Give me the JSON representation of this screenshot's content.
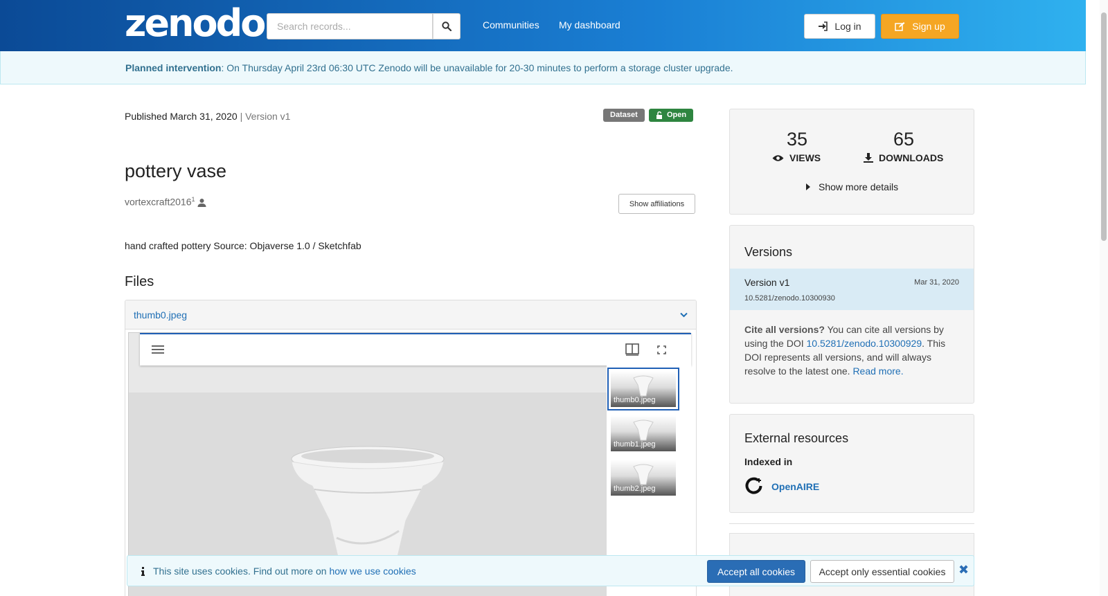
{
  "header": {
    "logo": "zenodo",
    "search_placeholder": "Search records...",
    "nav": [
      "Communities",
      "My dashboard"
    ],
    "login_label": "Log in",
    "signup_label": "Sign up"
  },
  "alert": {
    "bold": "Planned intervention",
    "text": ": On Thursday April 23rd 06:30 UTC Zenodo will be unavailable for 20-30 minutes to perform a storage cluster upgrade."
  },
  "record": {
    "published": "Published March 31, 2020",
    "version": "| Version v1",
    "badge_type": "Dataset",
    "badge_access": "Open",
    "title": "pottery vase",
    "creator": "vortexcraft2016",
    "creator_sup": "1",
    "show_affiliations": "Show affiliations",
    "description": "hand crafted pottery Source: Objaverse 1.0 / Sketchfab",
    "files_heading": "Files",
    "file_name": "thumb0.jpeg",
    "thumbs": [
      "thumb0.jpeg",
      "thumb1.jpeg",
      "thumb2.jpeg"
    ]
  },
  "stats": {
    "views_num": "35",
    "views_label": "VIEWS",
    "downloads_num": "65",
    "downloads_label": "DOWNLOADS",
    "show_more": "Show more details"
  },
  "versions": {
    "heading": "Versions",
    "item_label": "Version v1",
    "item_date": "Mar 31, 2020",
    "item_doi": "10.5281/zenodo.10300930",
    "cite_bold": "Cite all versions?",
    "cite_text1": " You can cite all versions by using the DOI ",
    "cite_doi": "10.5281/zenodo.10300929",
    "cite_text2": ". This DOI represents all versions, and will always resolve to the latest one. ",
    "read_more": "Read more."
  },
  "external": {
    "heading": "External resources",
    "indexed_in": "Indexed in",
    "openaire": "OpenAIRE"
  },
  "cookie": {
    "text": "This site uses cookies. Find out more on ",
    "link": "how we use cookies",
    "accept_all": "Accept all cookies",
    "accept_essential": "Accept only essential cookies"
  },
  "colors": {
    "header_start": "#0b4a96",
    "header_end": "#2fb1ef",
    "signup": "#f5a623",
    "open_badge": "#2e8540",
    "link": "#1f6fb5"
  }
}
